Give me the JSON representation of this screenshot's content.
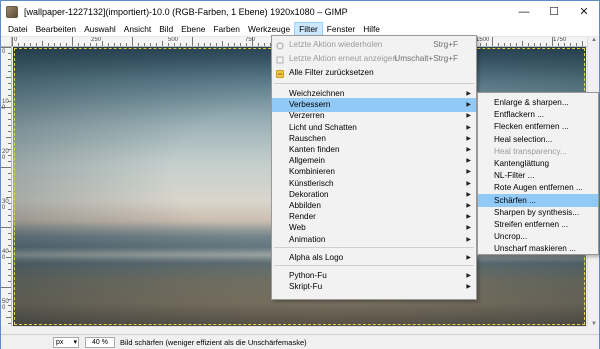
{
  "window": {
    "title": "[wallpaper-1227132](importiert)-10.0 (RGB-Farben, 1 Ebene) 1920x1080 – GIMP",
    "minimize": "—",
    "maximize": "☐",
    "close": "✕"
  },
  "menubar": [
    {
      "label": "Datei"
    },
    {
      "label": "Bearbeiten"
    },
    {
      "label": "Auswahl"
    },
    {
      "label": "Ansicht"
    },
    {
      "label": "Bild"
    },
    {
      "label": "Ebene"
    },
    {
      "label": "Farben"
    },
    {
      "label": "Werkzeuge"
    },
    {
      "label": "Filter",
      "active": true
    },
    {
      "label": "Fenster"
    },
    {
      "label": "Hilfe"
    }
  ],
  "ruler_top_labels": [
    "0",
    "250",
    "500",
    "750",
    "1000",
    "1250",
    "1500",
    "1750"
  ],
  "ruler_left_labels": [
    "0",
    "100",
    "200",
    "300",
    "400",
    "500"
  ],
  "filter_menu": {
    "items": [
      {
        "label": "Letzte Aktion wiederholen",
        "shortcut": "Strg+F",
        "disabled": true,
        "icon": "repeat-icon"
      },
      {
        "label": "Letzte Aktion erneut anzeigen",
        "shortcut": "Umschalt+Strg+F",
        "disabled": true,
        "icon": "reshow-icon"
      },
      {
        "label": "Alle Filter zurücksetzen",
        "shortcut": "",
        "disabled": false,
        "icon": "reset-icon"
      },
      {
        "separator": true
      },
      {
        "label": "Weichzeichnen",
        "submenu": true
      },
      {
        "label": "Verbessern",
        "submenu": true,
        "highlighted": true
      },
      {
        "label": "Verzerren",
        "submenu": true
      },
      {
        "label": "Licht und Schatten",
        "submenu": true
      },
      {
        "label": "Rauschen",
        "submenu": true
      },
      {
        "label": "Kanten finden",
        "submenu": true
      },
      {
        "label": "Allgemein",
        "submenu": true
      },
      {
        "label": "Kombinieren",
        "submenu": true
      },
      {
        "label": "Künstlerisch",
        "submenu": true
      },
      {
        "label": "Dekoration",
        "submenu": true
      },
      {
        "label": "Abbilden",
        "submenu": true
      },
      {
        "label": "Render",
        "submenu": true
      },
      {
        "label": "Web",
        "submenu": true
      },
      {
        "label": "Animation",
        "submenu": true
      },
      {
        "separator": true
      },
      {
        "label": "Alpha als Logo",
        "submenu": true
      },
      {
        "separator": true
      },
      {
        "label": "Python-Fu",
        "submenu": true
      },
      {
        "label": "Skript-Fu",
        "submenu": true
      }
    ]
  },
  "verbessern_submenu": {
    "items": [
      {
        "label": "Enlarge & sharpen..."
      },
      {
        "label": "Entflackern ..."
      },
      {
        "label": "Flecken entfernen ..."
      },
      {
        "label": "Heal selection..."
      },
      {
        "label": "Heal transparency...",
        "disabled": true
      },
      {
        "label": "Kantenglättung"
      },
      {
        "label": "NL-Filter ..."
      },
      {
        "label": "Rote Augen entfernen ..."
      },
      {
        "label": "Schärfen ...",
        "highlighted": true
      },
      {
        "label": "Sharpen by synthesis..."
      },
      {
        "label": "Streifen entfernen ..."
      },
      {
        "label": "Uncrop..."
      },
      {
        "label": "Unscharf maskieren ..."
      }
    ]
  },
  "statusbar": {
    "unit": "px",
    "zoom": "40 %",
    "message": "Bild schärfen (weniger effizient als die Unschärfemaske)"
  },
  "colors": {
    "highlight": "#91c9f7",
    "menubar_active": "#cce8ff",
    "window_border": "#5a8ec6"
  }
}
